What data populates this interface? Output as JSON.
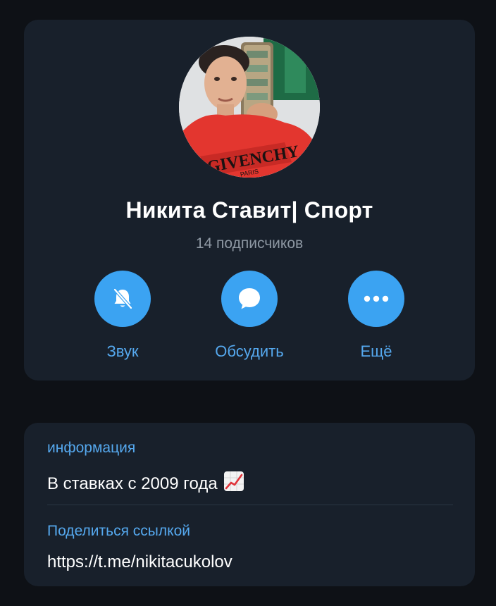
{
  "profile": {
    "title": "Никита Ставит| Спорт",
    "subscribers": "14 подписчиков",
    "avatar_alt": "channel-avatar"
  },
  "actions": [
    {
      "label": "Звук",
      "icon": "bell-muted-icon"
    },
    {
      "label": "Обсудить",
      "icon": "chat-bubble-icon"
    },
    {
      "label": "Ещё",
      "icon": "more-dots-icon"
    }
  ],
  "info": {
    "about_label": "информация",
    "about_text": "В ставках с 2009 года",
    "about_emoji": "chart-increasing-icon",
    "link_label": "Поделиться ссылкой",
    "link_value": "https://t.me/nikitacukolov"
  },
  "colors": {
    "background": "#0e1116",
    "card": "#18202b",
    "accent": "#3ba3f2",
    "accent_text": "#55a8ee",
    "muted_text": "#8e98a3"
  }
}
